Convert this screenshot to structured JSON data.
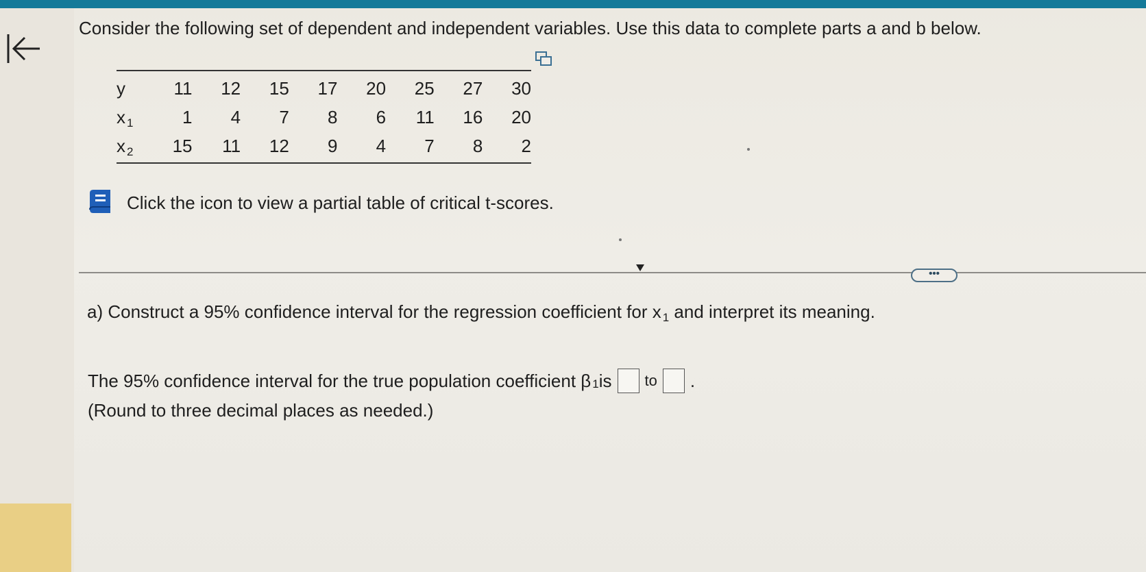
{
  "header": {
    "accent_color": "#157a99"
  },
  "question": {
    "prompt": "Consider the following set of dependent and independent variables. Use this data to complete parts a and b below."
  },
  "table": {
    "rows": [
      {
        "label": "y",
        "subscript": "",
        "values": [
          "11",
          "12",
          "15",
          "17",
          "20",
          "25",
          "27",
          "30"
        ]
      },
      {
        "label": "x",
        "subscript": "1",
        "values": [
          "1",
          "4",
          "7",
          "8",
          "6",
          "11",
          "16",
          "20"
        ]
      },
      {
        "label": "x",
        "subscript": "2",
        "values": [
          "15",
          "11",
          "12",
          "9",
          "4",
          "7",
          "8",
          "2"
        ]
      }
    ]
  },
  "reference": {
    "link_text": "Click the icon to view a partial table of critical t-scores."
  },
  "more_button": {
    "label": "•••"
  },
  "part_a": {
    "prefix": "a) Construct a 95% confidence interval for the regression coefficient for x",
    "subscript": "1",
    "suffix": " and interpret its meaning.",
    "answer_prefix": "The 95% confidence interval for the true population coefficient β",
    "answer_subscript": "1",
    "answer_mid": " is",
    "answer_to": "to",
    "answer_end": ".",
    "answer_lower": "",
    "answer_upper": "",
    "note": "(Round to three decimal places as needed.)"
  },
  "icons": {
    "back": "back-arrow-icon",
    "copy": "copy-table-icon",
    "reference": "book-icon"
  }
}
